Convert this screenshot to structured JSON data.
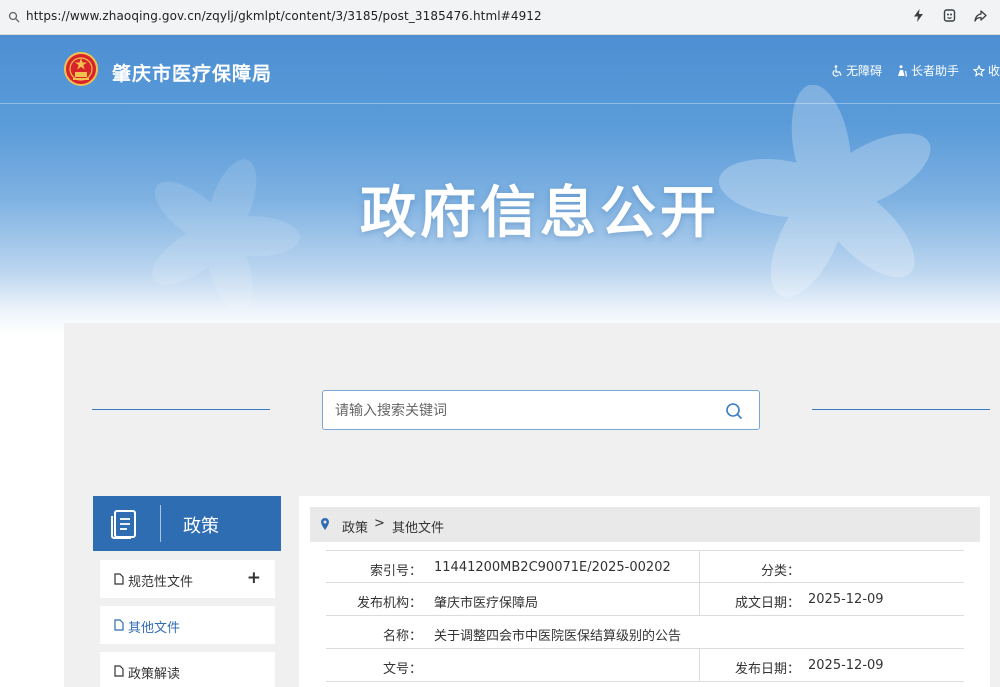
{
  "browser": {
    "url": "https://www.zhaoqing.gov.cn/zqylj/gkmlpt/content/3/3185/post_3185476.html#4912"
  },
  "header": {
    "site_title": "肇庆市医疗保障局",
    "hero_title": "政府信息公开",
    "links": [
      {
        "label": "无障碍",
        "icon": "wheelchair-icon"
      },
      {
        "label": "长者助手",
        "icon": "elder-icon"
      },
      {
        "label": "收",
        "icon": "star-icon"
      }
    ]
  },
  "search": {
    "placeholder": "请输入搜索关键词"
  },
  "sidebar": {
    "title": "政策",
    "items": [
      {
        "label": "规范性文件",
        "expand": "+"
      },
      {
        "label": "其他文件"
      },
      {
        "label": "政策解读"
      }
    ]
  },
  "breadcrumb": {
    "items": [
      "政策",
      "其他文件"
    ],
    "separator": ">"
  },
  "info": {
    "index_label": "索引号：",
    "index_value": "11441200MB2C90071E/2025-00202",
    "category_label": "分类：",
    "category_value": "",
    "publisher_label": "发布机构：",
    "publisher_value": "肇庆市医疗保障局",
    "created_label": "成文日期：",
    "created_value": "2025-12-09",
    "name_label": "名称：",
    "name_value": "关于调整四会市中医院医保结算级别的公告",
    "docno_label": "文号：",
    "docno_value": "",
    "pubdate_label": "发布日期：",
    "pubdate_value": "2025-12-09"
  },
  "colors": {
    "primary": "#2f6db3",
    "banner_top": "#4d8fd2",
    "background": "#f0f0f0"
  }
}
